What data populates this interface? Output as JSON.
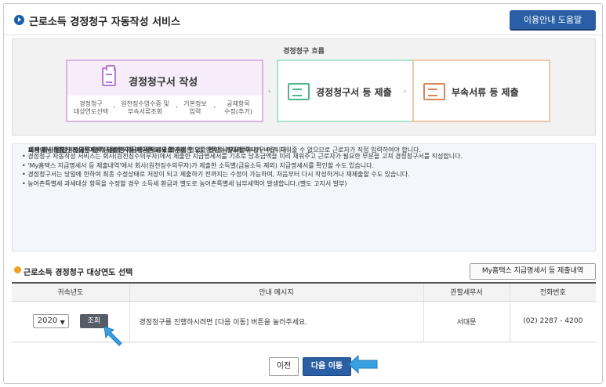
{
  "header": {
    "title": "근로소득 경정청구 자동작성 서비스",
    "help_button": "이용안내 도움말"
  },
  "flow": {
    "label": "경정청구 흐름",
    "step1": {
      "title": "경정청구서 작성",
      "substeps": [
        "경정청구\n대상연도선택",
        "원천징수영수증 및\n부속서류조회",
        "기본정보\n입력",
        "공제항목\n수정(추가)"
      ]
    },
    "step2": {
      "title": "경정청구서 등 제출"
    },
    "step3": {
      "title": "부속서류 등 제출"
    }
  },
  "notice": [
    {
      "text": "• 경정청구 자동작성 서비스는 회사(원천징수의무자)에서 제출한 지급명세서를 기초로 당초금액을 미리 채워주고 근로자가 필요한 부분을 고쳐 경정청구서를 작성합니다.",
      "sub": false
    },
    {
      "text": "또한 계산절차가 필요한 항목은 계산기를 제공하고 있습니다.",
      "sub": true
    },
    {
      "text": "다만 회사(원천징수의무자)가 제출한 지급명세서에서 확인할 수 없는 일부 세부사항의 경우 미리 채워줄 수 없으므로 근로자가 직접 입력하여야 합니다.",
      "sub": true
    },
    {
      "text": "• 'My홈택스 지급명세서 등 제출내역'에서 회사(원천징수의무자)가 제출한 소득별(금융소득 제외) 지급명세서를 확인할 수도 있습니다.",
      "sub": false
    },
    {
      "text": "회사에서 제출한 지급명세서 내용이 사실과 다른 경우 회사에 별도로 확인이 필요합니다.",
      "sub": true
    },
    {
      "text": "• 경정청구서는 당일에 한하여 최종 수정상태로 저장이 되고 제출하기 전까지는 수정이 가능하며, 처음부터 다시 작성하거나 재제출할 수도 있습니다.",
      "sub": false
    },
    {
      "text": "재제출 시 당일 작성된 이전의 경정청구서가 삭제되므로 수정한 모든항목을 기재해 주시기 바랍니다.",
      "sub": true
    },
    {
      "text": "• 농어촌특별세 과세대상 항목을 수정할 경우 소득세 환급과 별도로 농어촌특별세 납부세액이 발생합니다.(별도 고지서 발부)",
      "sub": false
    }
  ],
  "section": {
    "title": "근로소득 경정청구 대상연도 선택",
    "my_button": "My홈택스 지급명세서 등 제출내역"
  },
  "table": {
    "headers": [
      "귀속년도",
      "안내 메시지",
      "관할세무서",
      "전화번호"
    ],
    "row": {
      "year": "2020",
      "lookup": "조회",
      "message": "경정청구를 진행하시려면 [다음 이동] 버튼을 눌러주세요.",
      "office": "서대문",
      "phone": "(02) 2287 - 4200"
    }
  },
  "buttons": {
    "prev": "이전",
    "next": "다음 이동"
  },
  "colors": {
    "brand": "#2a5ea5",
    "pointer": "#3aa0e0"
  }
}
